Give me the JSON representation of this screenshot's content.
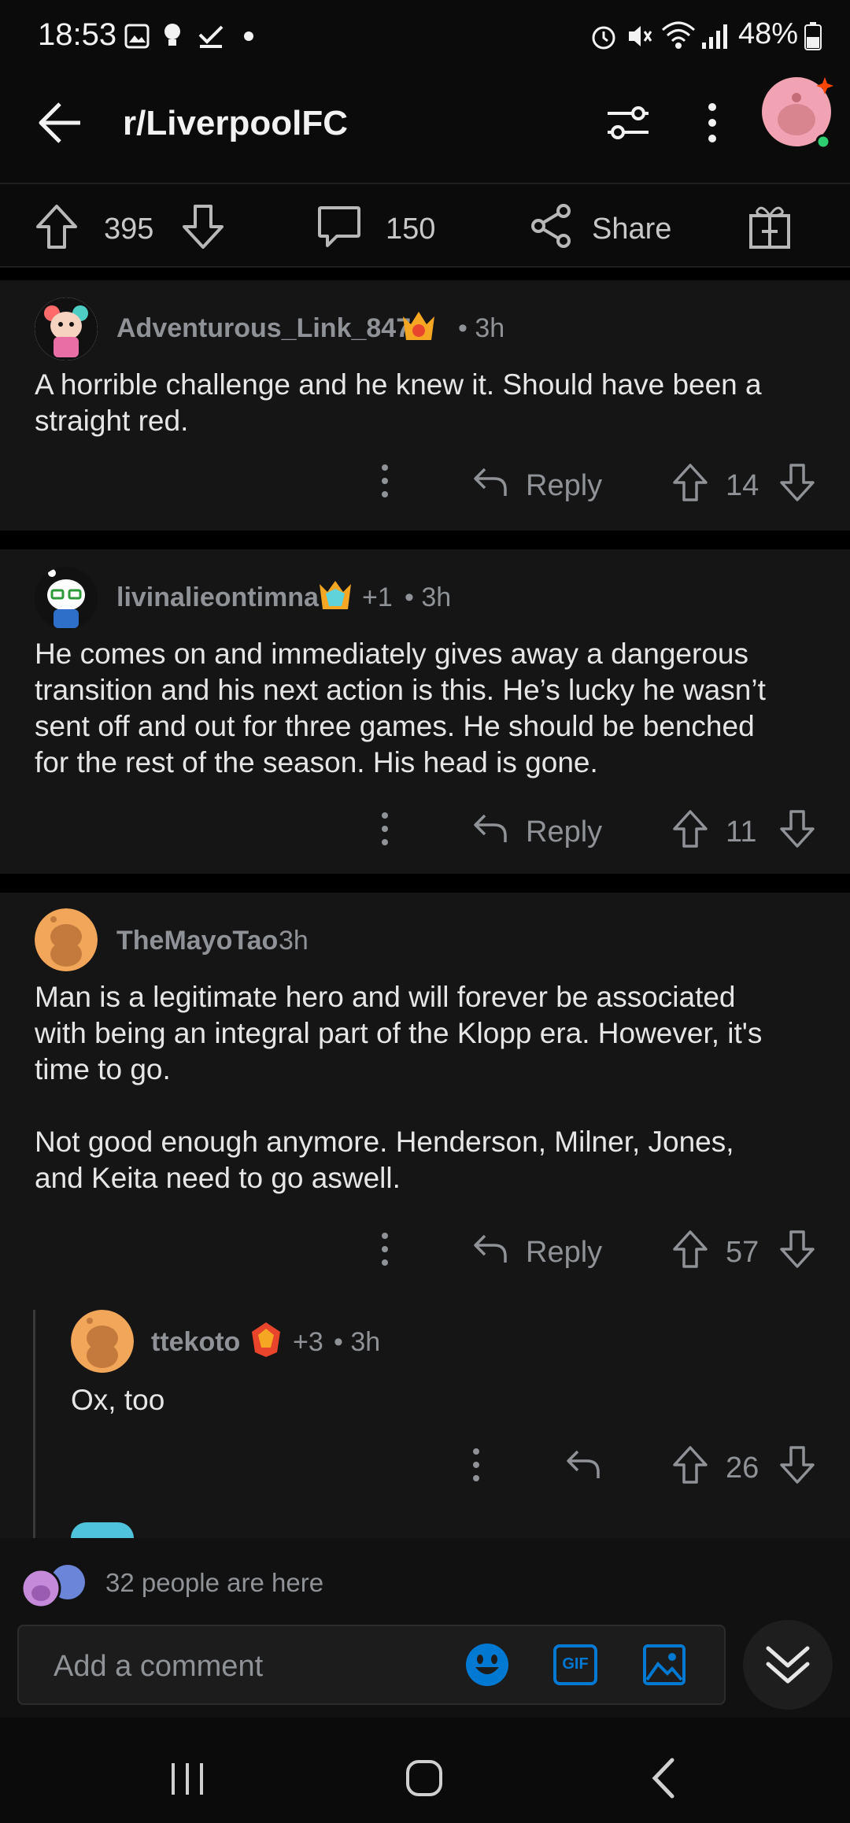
{
  "status_bar": {
    "time": "18:53",
    "battery": "48%"
  },
  "header": {
    "title": "r/LiverpoolFC"
  },
  "post_actions": {
    "upvotes": "395",
    "comments": "150",
    "share_label": "Share"
  },
  "comments": [
    {
      "username": "Adventurous_Link_847",
      "flair": "",
      "time": "• 3h",
      "body": "A horrible challenge and he knew it. Should have been a\nstraight red.",
      "reply_label": "Reply",
      "score": "14"
    },
    {
      "username": "livinalieontimna",
      "flair": "+1",
      "time": "• 3h",
      "body": "He comes on and immediately gives away a dangerous\ntransition and his next action is this. He’s lucky he wasn’t\nsent off and out for three games. He should be benched\nfor the rest of the season. His head is gone.",
      "reply_label": "Reply",
      "score": "11"
    },
    {
      "username": "TheMayoTao",
      "flair": "",
      "time": "3h",
      "body": "Man is a legitimate hero and will forever be associated\nwith being an integral part of the Klopp era. However, it's\ntime to go.\n\nNot good enough anymore. Henderson, Milner, Jones,\nand Keita need to go aswell.",
      "reply_label": "Reply",
      "score": "57"
    },
    {
      "username": "ttekoto",
      "flair": "+3",
      "time": "• 3h",
      "body": "Ox, too",
      "reply_label": "",
      "score": "26"
    }
  ],
  "presence": {
    "text": "32 people are here"
  },
  "composer": {
    "placeholder": "Add a comment",
    "gif_label": "GIF"
  },
  "colors": {
    "background": "#0b0b0b",
    "card": "#151515",
    "muted": "#8f9296",
    "accent_blue": "#0079d3"
  }
}
